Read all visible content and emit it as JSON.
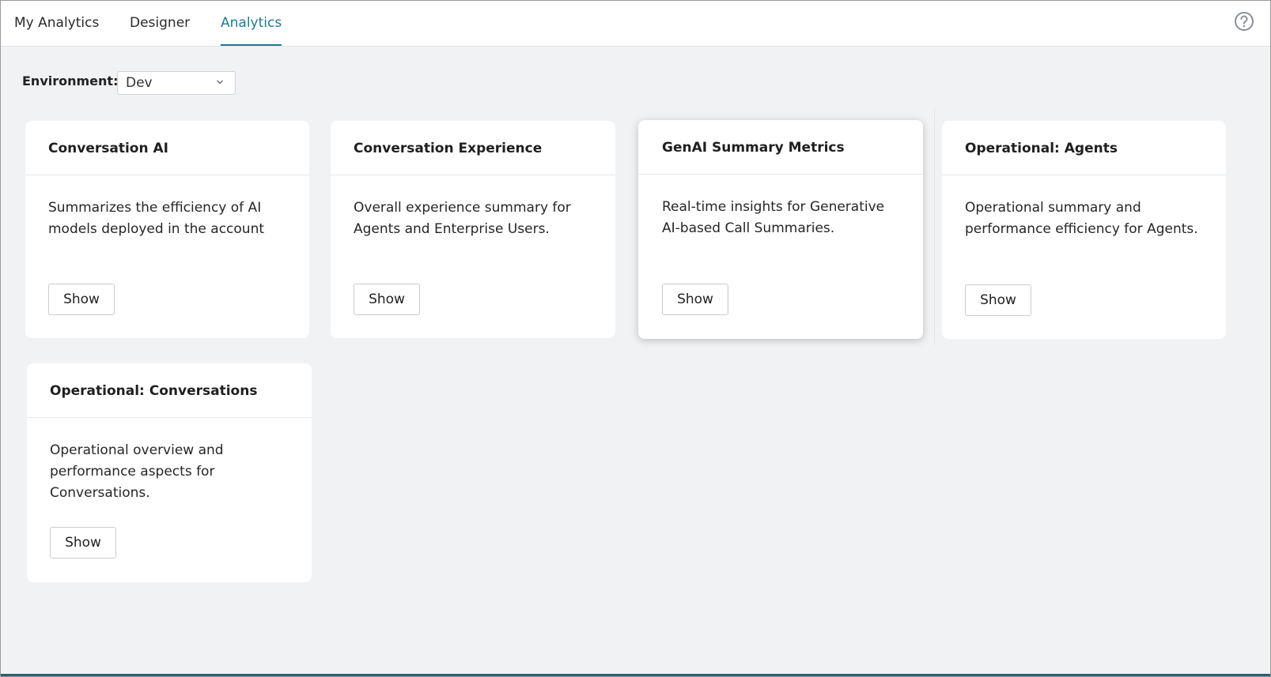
{
  "tabs": [
    {
      "label": "My Analytics"
    },
    {
      "label": "Designer"
    },
    {
      "label": "Analytics"
    }
  ],
  "header": {
    "help_icon": "help-circle-icon"
  },
  "environment": {
    "label": "Environment:",
    "selected": "Dev",
    "chevron_icon": "chevron-down-icon"
  },
  "cards": [
    {
      "title": "Conversation AI",
      "description": "Summarizes the efficiency of AI models deployed in the account",
      "button": "Show"
    },
    {
      "title": "Conversation Experience",
      "description": "Overall experience summary for Agents and Enterprise Users.",
      "button": "Show"
    },
    {
      "title": "GenAI Summary Metrics",
      "description": "Real-time insights for Generative AI-based Call Summaries.",
      "button": "Show"
    },
    {
      "title": "Operational: Agents",
      "description": "Operational summary and performance efficiency for Agents.",
      "button": "Show"
    },
    {
      "title": "Operational: Conversations",
      "description": "Operational overview and performance aspects for Conversations.",
      "button": "Show"
    }
  ],
  "colors": {
    "accent": "#1a7d92",
    "background": "#f1f2f4"
  }
}
